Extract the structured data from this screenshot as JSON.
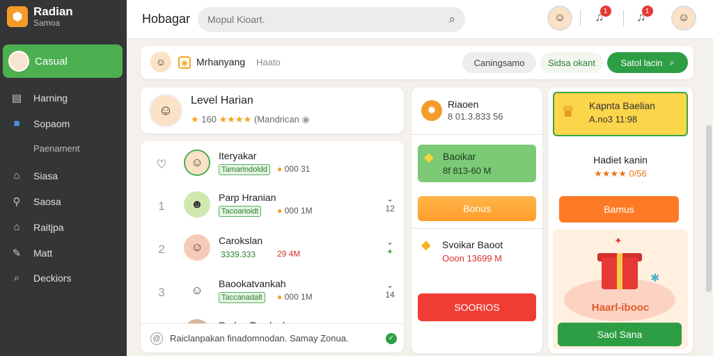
{
  "sidebar": {
    "brand_title": "Radian",
    "brand_sub": "Samoa",
    "active_item": "Casual",
    "items": [
      {
        "label": "Harning",
        "icon": "document-icon"
      },
      {
        "label": "Sopaom",
        "icon": "folder-icon"
      },
      {
        "label": "Siasa",
        "icon": "home-icon"
      },
      {
        "label": "Saosa",
        "icon": "pin-icon"
      },
      {
        "label": "Raitjpa",
        "icon": "home-icon"
      },
      {
        "label": "Matt",
        "icon": "wrench-icon"
      },
      {
        "label": "Deckiors",
        "icon": "search-icon"
      }
    ],
    "subitem": "Paenament"
  },
  "topbar": {
    "title": "Hobagar",
    "search_placeholder": "Mopul Kioart.",
    "badge_1": "1",
    "badge_2": "1"
  },
  "header": {
    "name": "Mrhanyang",
    "sub": "Haato",
    "btn_grey": "Caningsamo",
    "btn_ghost": "Sidsa okant",
    "btn_green": "Satol lacin"
  },
  "level": {
    "title": "Level Harian",
    "points": "160",
    "stars": "★★★★",
    "sub": "Mandrican"
  },
  "leaderboard": [
    {
      "rank": "",
      "name": "Iteryakar",
      "tag": "Tamarindoldd",
      "pts": "000 31",
      "right_top": "",
      "right_bottom": ""
    },
    {
      "rank": "1",
      "name": "Parp Hranian",
      "tag": "Tacoarioidt",
      "pts": "000 1M",
      "right_top": "⌄",
      "right_bottom": "12"
    },
    {
      "rank": "2",
      "name": "Carokslan",
      "tag": "3339.333",
      "pts": "29 4M",
      "right_top": "⌄",
      "right_bottom": ""
    },
    {
      "rank": "3",
      "name": "Baookatvankah",
      "tag": "Taccanadalt",
      "pts": "000 1M",
      "right_top": "⌄",
      "right_bottom": "14"
    },
    {
      "rank": "",
      "name": "Rorlon Tranlanh",
      "tag": "",
      "pts": "",
      "right_top": "",
      "right_bottom": ""
    }
  ],
  "footer_note": "Raiclanpakan finadomnodan.  Samay Zonua.",
  "middle": {
    "sec1_title": "Riaoen",
    "sec1_value": "8 01.3.833 56",
    "green_title": "Baoikar",
    "green_value": "8f 813-60 M",
    "bonus_label": "Bonus",
    "sec2_title": "Svoikar Baoot",
    "sec2_value": "Ooon 13699 M",
    "red_label": "SOORIOS"
  },
  "right": {
    "yellow_title": "Kapnta Baelian",
    "yellow_value": "A.no3 11:98",
    "sec_title": "Hadiet kanin",
    "sec_value": "★★★★ 0/56",
    "orange_label": "Bamus",
    "gift_text": "Haarl-ibooc",
    "green_label": "Saol Sana"
  }
}
